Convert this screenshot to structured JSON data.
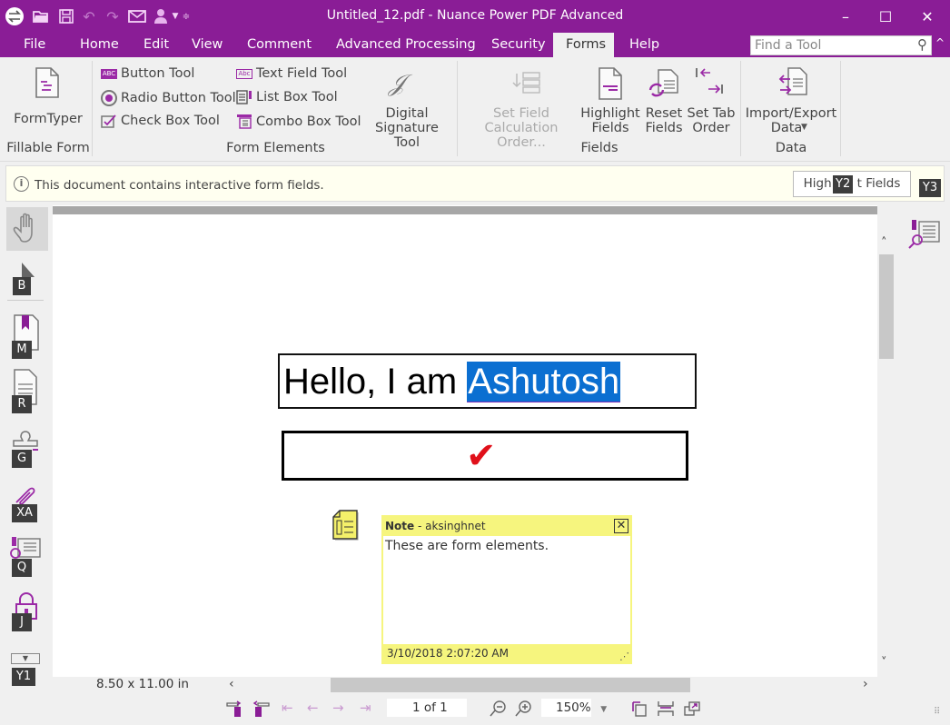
{
  "window": {
    "title": "Untitled_12.pdf - Nuance Power PDF Advanced",
    "minimize": "–",
    "maximize": "☐",
    "close": "✕"
  },
  "quick_access": [
    "app-switch-icon",
    "open-folder-icon",
    "save-icon",
    "undo-icon",
    "redo-icon",
    "email-icon",
    "user-icon",
    "dropdown-icon",
    "customize-icon"
  ],
  "menu": {
    "tabs": [
      {
        "label": "File"
      },
      {
        "label": "Home"
      },
      {
        "label": "Edit"
      },
      {
        "label": "View"
      },
      {
        "label": "Comment"
      },
      {
        "label": "Advanced Processing"
      },
      {
        "label": "Security"
      },
      {
        "label": "Forms",
        "active": true
      },
      {
        "label": "Help"
      }
    ],
    "find_placeholder": "Find a Tool"
  },
  "ribbon": {
    "fillable_form": {
      "group_label": "Fillable Form",
      "formtyper": "FormTyper"
    },
    "form_elements": {
      "group_label": "Form Elements",
      "button_tool": "Button Tool",
      "radio_button_tool": "Radio Button Tool",
      "check_box_tool": "Check Box Tool",
      "text_field_tool": "Text Field Tool",
      "list_box_tool": "List Box Tool",
      "combo_box_tool": "Combo Box Tool",
      "digital_signature_line1": "Digital",
      "digital_signature_line2": "Signature Tool"
    },
    "fields": {
      "group_label": "Fields",
      "set_field_calc_line1": "Set Field",
      "set_field_calc_line2": "Calculation Order...",
      "highlight_line1": "Highlight",
      "highlight_line2": "Fields",
      "reset_line1": "Reset",
      "reset_line2": "Fields",
      "tab_order_line1": "Set Tab",
      "tab_order_line2": "Order"
    },
    "data": {
      "group_label": "Data",
      "import_export_line1": "Import/Export",
      "import_export_line2": "Data"
    }
  },
  "infobar": {
    "message": "This document contains interactive form fields.",
    "button": "Highlight Fields",
    "button_visible_left": "High",
    "button_visible_right": "t Fields"
  },
  "keytips": {
    "b": "B",
    "m": "M",
    "r": "R",
    "g": "G",
    "xa": "XA",
    "q": "Q",
    "j": "J",
    "y1": "Y1",
    "y2": "Y2",
    "y3": "Y3"
  },
  "document": {
    "text_field_prefix": "Hello, I am ",
    "text_field_selected": "Ashutosh",
    "checkbox_checked": true,
    "checkmark": "✔",
    "note": {
      "title": "Note",
      "author": " - aksinghnet",
      "body": "These are form elements.",
      "timestamp": "3/10/2018 2:07:20 AM"
    }
  },
  "status": {
    "page_size": "8.50 x 11.00 in",
    "page_indicator": "1 of 1",
    "zoom": "150%"
  },
  "colors": {
    "brand": "#8a1d96",
    "selection": "#0b6fd1",
    "note_yellow": "#f6f57e",
    "check_red": "#e0101a"
  }
}
